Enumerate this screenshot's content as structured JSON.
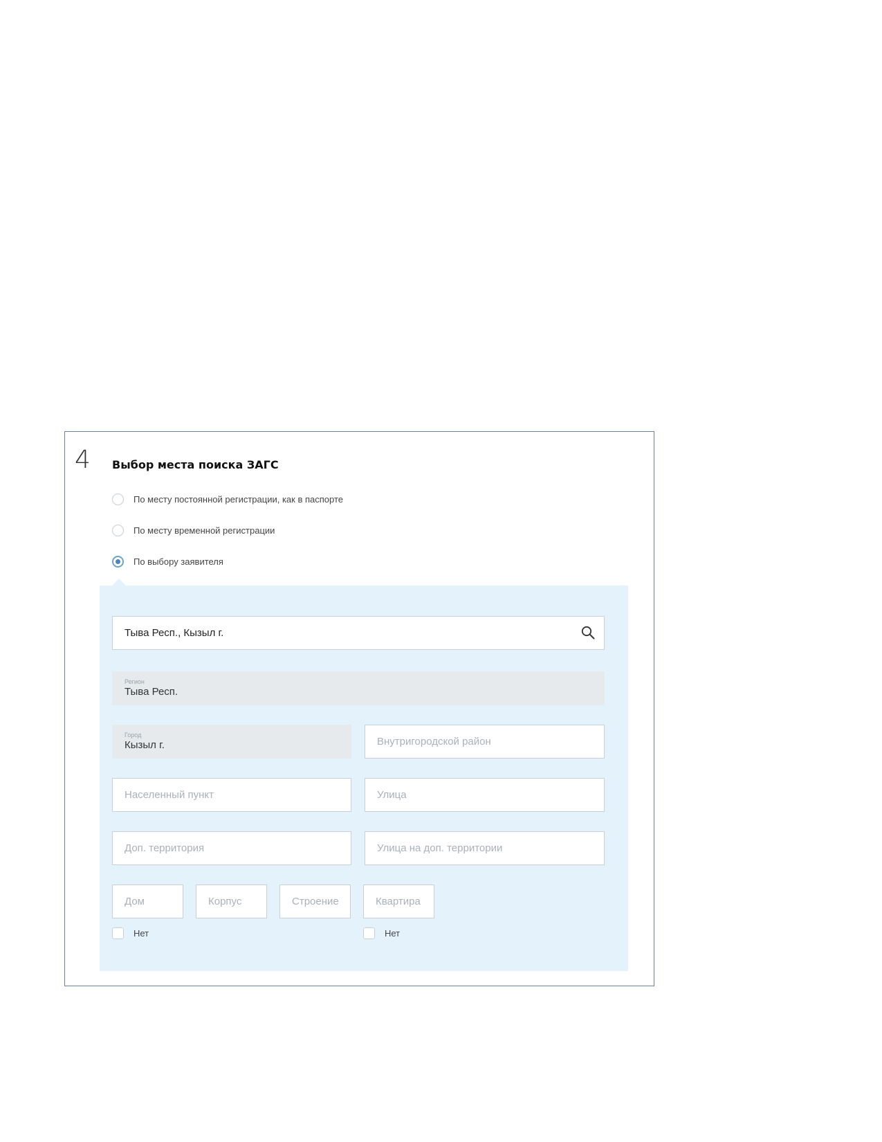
{
  "section": {
    "step_number": "4",
    "title": "Выбор места поиска ЗАГС"
  },
  "search_place_options": [
    {
      "label": "По месту постоянной регистрации, как в паспорте",
      "selected": false
    },
    {
      "label": "По месту временной регистрации",
      "selected": false
    },
    {
      "label": "По выбору заявителя",
      "selected": true
    }
  ],
  "address": {
    "search_value": "Тыва Респ., Кызыл г.",
    "region_label": "Регион",
    "region_value": "Тыва Респ.",
    "city_label": "Город",
    "city_value": "Кызыл г.",
    "district_placeholder": "Внутригородской район",
    "settlement_placeholder": "Населенный пункт",
    "street_placeholder": "Улица",
    "extra_territory_placeholder": "Доп. территория",
    "extra_street_placeholder": "Улица на доп. территории",
    "house_placeholder": "Дом",
    "building_placeholder": "Корпус",
    "structure_placeholder": "Строение",
    "apartment_placeholder": "Квартира",
    "no_house_label": "Нет",
    "no_apartment_label": "Нет"
  },
  "colors": {
    "panel_bg": "#e4f3fb",
    "frame_border": "#6b7fa3",
    "radio_accent": "#4a86b8",
    "disabled_field_bg": "#e6eaed"
  },
  "icons": {
    "search": "search-icon"
  }
}
